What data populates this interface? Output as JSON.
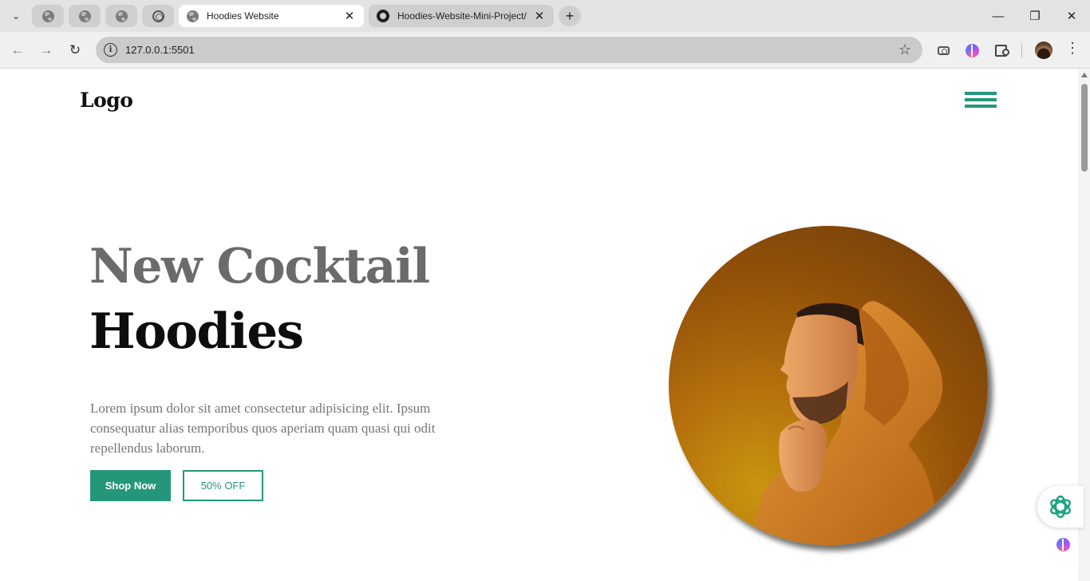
{
  "browser": {
    "tabs": [
      {
        "title": "Hoodies Website",
        "active": true,
        "icon": "globe-icon"
      },
      {
        "title": "Hoodies-Website-Mini-Project/",
        "active": false,
        "icon": "github-icon"
      }
    ],
    "pinned_tabs": [
      "globe-icon",
      "globe-icon",
      "globe-icon",
      "chatgpt-icon"
    ],
    "address": "127.0.0.1:5501",
    "icons": [
      "back-icon",
      "forward-icon",
      "reload-icon",
      "info-icon",
      "bookmark-star-icon",
      "screenshot-icon",
      "brain-extension-icon",
      "extensions-icon",
      "profile-avatar",
      "menu-icon"
    ]
  },
  "site": {
    "logo": "Logo",
    "headline_line1": "New Cocktail",
    "headline_line2": "Hoodies",
    "description": "Lorem ipsum dolor sit amet consectetur adipisicing elit. Ipsum consequatur alias temporibus quos aperiam quam quasi qui odit repellendus laborum.",
    "primary_button": "Shop Now",
    "secondary_button": "50% OFF"
  },
  "colors": {
    "accent": "#24977a",
    "headline_gray": "#6b6b6b",
    "headline_black": "#0d0d0d",
    "body_text": "#757575"
  }
}
